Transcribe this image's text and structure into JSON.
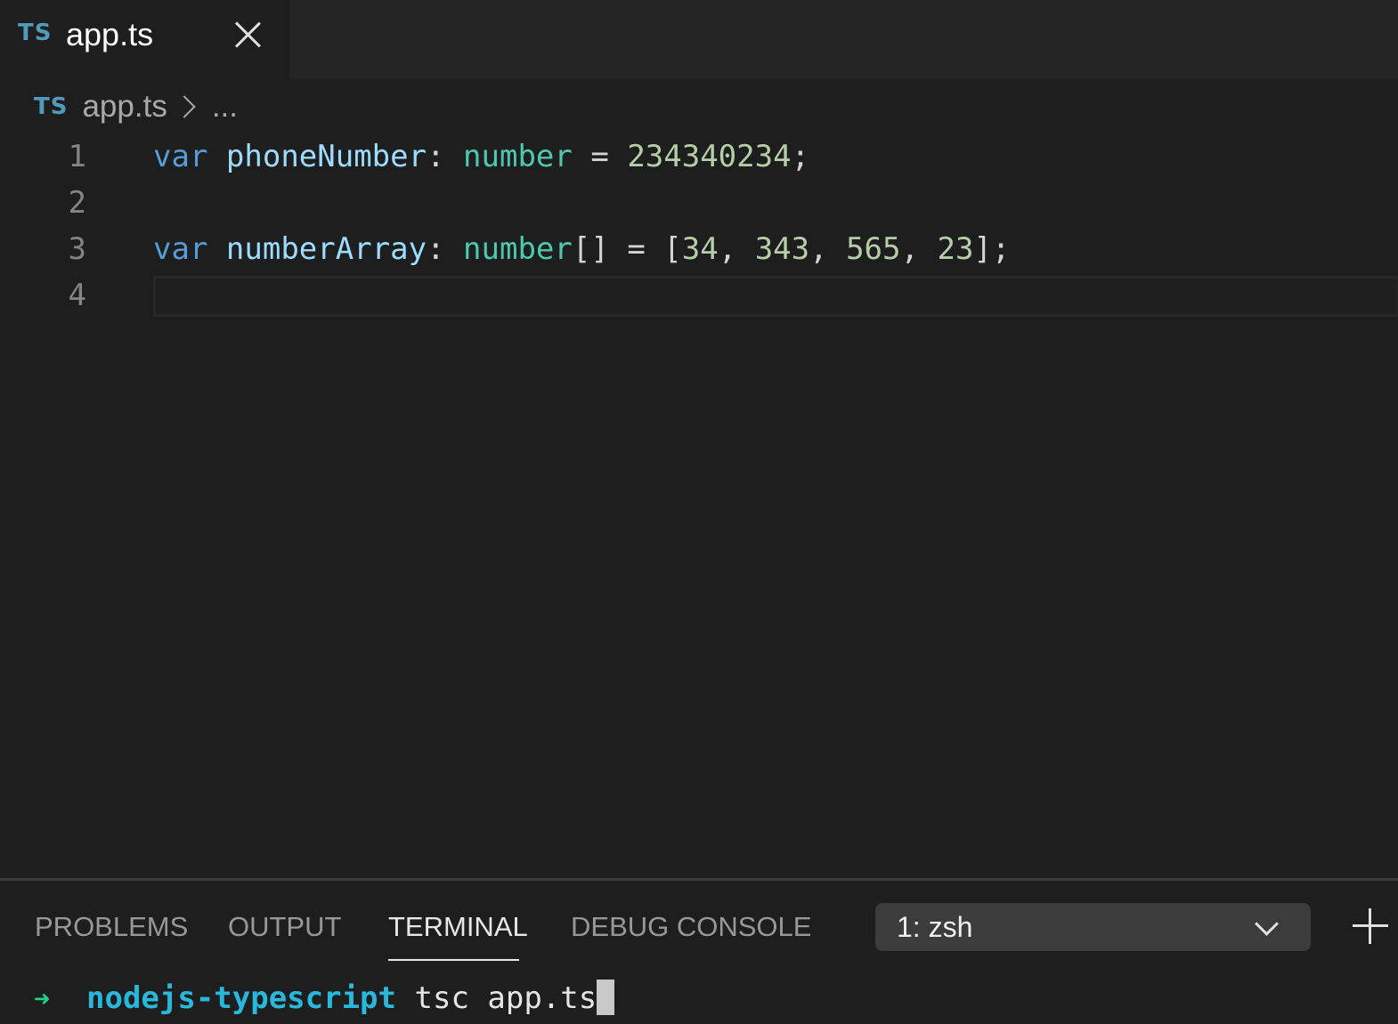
{
  "tab": {
    "badge": "TS",
    "label": "app.ts"
  },
  "breadcrumb": {
    "badge": "TS",
    "file": "app.ts",
    "more": "..."
  },
  "editor": {
    "line_numbers": [
      "1",
      "2",
      "3",
      "4"
    ],
    "line1": {
      "kw": "var",
      "id": "phoneNumber",
      "colon": ":",
      "type": "number",
      "eq": "=",
      "value": "234340234",
      "semi": ";"
    },
    "line3": {
      "kw": "var",
      "id": "numberArray",
      "colon": ":",
      "type": "number",
      "type_suffix": "[]",
      "eq": "=",
      "open": "[",
      "v1": "34",
      "v2": "343",
      "v3": "565",
      "v4": "23",
      "sep": ",",
      "close": "]",
      "semi": ";"
    }
  },
  "panel": {
    "tabs": [
      "PROBLEMS",
      "OUTPUT",
      "TERMINAL",
      "DEBUG CONSOLE"
    ],
    "active_tab": "TERMINAL",
    "terminal_select": "1: zsh"
  },
  "terminal": {
    "prompt_arrow": "➜",
    "directory": "nodejs-typescript",
    "command": "tsc app.ts"
  },
  "colors": {
    "background": "#1e1e1e",
    "keyword": "#569cd6",
    "identifier": "#9cdcfe",
    "type": "#4ec9b0",
    "number": "#b5cea8",
    "prompt_arrow": "#23d18b",
    "directory": "#29b8db"
  },
  "icons": [
    "close-icon",
    "chevron-right-icon",
    "chevron-down-icon",
    "plus-icon"
  ]
}
